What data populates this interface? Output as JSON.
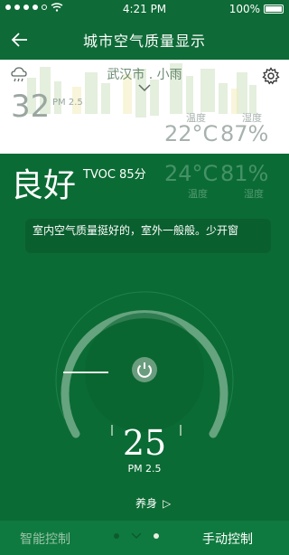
{
  "status_bar": {
    "time": "4:21 PM",
    "battery": "100%"
  },
  "nav": {
    "title": "城市空气质量显示"
  },
  "weather": {
    "city": "武汉市 . 小雨",
    "pm_value": "32",
    "pm_unit": "PM 2.5",
    "temp_label": "温度",
    "hum_label": "湿度",
    "temp_value": "22°C",
    "hum_value": "87%"
  },
  "indoor": {
    "quality": "良好",
    "tvoc": "TVOC 85分",
    "temp_value": "24°C",
    "hum_value": "81%",
    "temp_label": "温度",
    "hum_label": "湿度",
    "advice": "室内空气质量挺好的，室外一般般。少开窗"
  },
  "control": {
    "setpoint": "25",
    "setpoint_unit": "PM 2.5",
    "mode": "养身",
    "mode_arrow": "▷"
  },
  "bottom_bar": {
    "left": "智能控制",
    "right": "手动控制"
  },
  "colors": {
    "primary": "#0b6b34",
    "bar": "#0f7a3f",
    "card": "#ffffff",
    "muted": "#a7b2ac",
    "gauge": "#66a37f"
  },
  "icons": {
    "back": "back-arrow-icon",
    "rain": "rain-cloud-icon",
    "dropdown": "chevron-down-icon",
    "settings": "gear-icon",
    "power": "power-icon"
  }
}
